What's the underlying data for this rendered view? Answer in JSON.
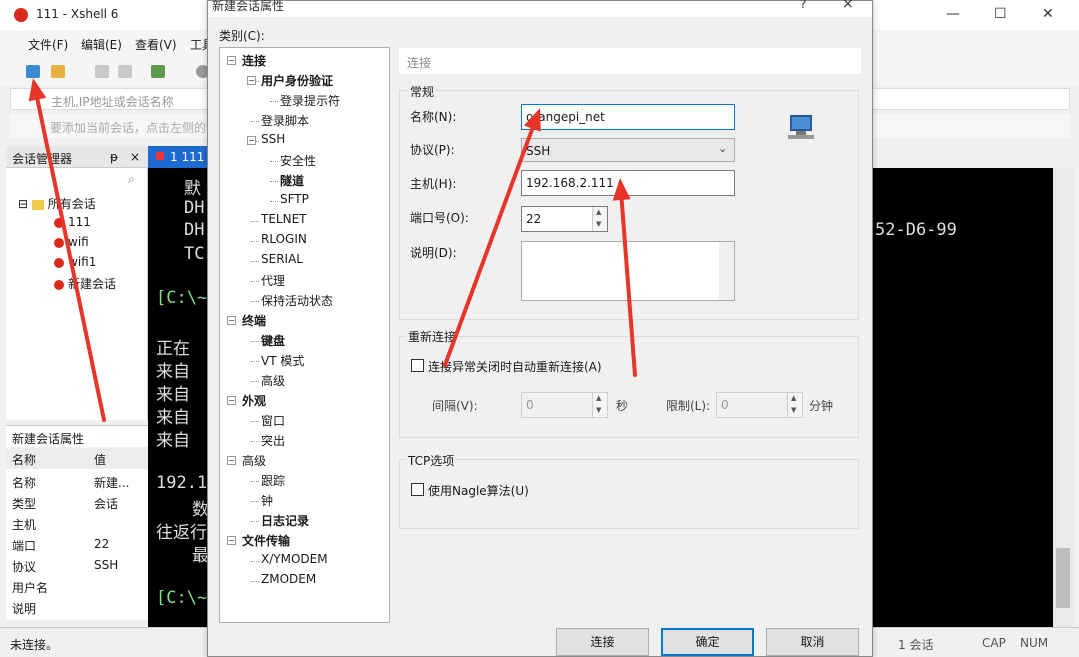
{
  "window": {
    "title": "111 - Xshell 6"
  },
  "menu": [
    "文件(F)",
    "编辑(E)",
    "查看(V)",
    "工具"
  ],
  "address_placeholder": "主机,IP地址或会话名称",
  "hint_text": "要添加当前会话，点击左侧的箭",
  "session_manager": {
    "title": "会话管理器",
    "pin": "ᵽ",
    "close": "×",
    "root": "所有会话",
    "items": [
      "111",
      "wifi",
      "wifi1",
      "新建会话"
    ]
  },
  "properties": {
    "title": "新建会话属性",
    "col_name": "名称",
    "col_value": "值",
    "rows": [
      [
        "名称",
        "新建..."
      ],
      [
        "类型",
        "会话"
      ],
      [
        "主机",
        ""
      ],
      [
        "端口",
        "22"
      ],
      [
        "协议",
        "SSH"
      ],
      [
        "用户名",
        ""
      ],
      [
        "说明",
        ""
      ]
    ]
  },
  "status": {
    "left": "未连接。",
    "sessions": "1 会话",
    "caps": "CAP",
    "num": "NUM"
  },
  "terminal": {
    "tab": "1 111",
    "lines": [
      "默",
      "DH(",
      "DH(",
      "TC",
      "",
      "[C:\\~",
      "",
      "正在",
      "来自",
      "来自",
      "来自",
      "来自",
      "",
      "192.1",
      "数",
      "往返行",
      "最",
      "",
      "[C:\\~"
    ],
    "right_text": "52-D6-99"
  },
  "dialog": {
    "title": "新建会话属性",
    "help": "?",
    "close": "×",
    "category_label": "类别(C):",
    "tree": [
      {
        "label": "连接",
        "level": 0,
        "bold": true
      },
      {
        "label": "用户身份验证",
        "level": 1,
        "bold": true
      },
      {
        "label": "登录提示符",
        "level": 2,
        "bold": false
      },
      {
        "label": "登录脚本",
        "level": 1,
        "bold": false
      },
      {
        "label": "SSH",
        "level": 1,
        "bold": false
      },
      {
        "label": "安全性",
        "level": 2,
        "bold": false
      },
      {
        "label": "隧道",
        "level": 2,
        "bold": true
      },
      {
        "label": "SFTP",
        "level": 2,
        "bold": false
      },
      {
        "label": "TELNET",
        "level": 1,
        "bold": false
      },
      {
        "label": "RLOGIN",
        "level": 1,
        "bold": false
      },
      {
        "label": "SERIAL",
        "level": 1,
        "bold": false
      },
      {
        "label": "代理",
        "level": 1,
        "bold": false
      },
      {
        "label": "保持活动状态",
        "level": 1,
        "bold": false
      },
      {
        "label": "终端",
        "level": 0,
        "bold": true
      },
      {
        "label": "键盘",
        "level": 1,
        "bold": true
      },
      {
        "label": "VT 模式",
        "level": 1,
        "bold": false
      },
      {
        "label": "高级",
        "level": 1,
        "bold": false
      },
      {
        "label": "外观",
        "level": 0,
        "bold": true
      },
      {
        "label": "窗口",
        "level": 1,
        "bold": false
      },
      {
        "label": "突出",
        "level": 1,
        "bold": false
      },
      {
        "label": "高级",
        "level": 0,
        "bold": false
      },
      {
        "label": "跟踪",
        "level": 1,
        "bold": false
      },
      {
        "label": "钟",
        "level": 1,
        "bold": false
      },
      {
        "label": "日志记录",
        "level": 1,
        "bold": true
      },
      {
        "label": "文件传输",
        "level": 0,
        "bold": true
      },
      {
        "label": "X/YMODEM",
        "level": 1,
        "bold": false
      },
      {
        "label": "ZMODEM",
        "level": 1,
        "bold": false
      }
    ],
    "panel_title": "连接",
    "general": {
      "label": "常规",
      "name_label": "名称(N):",
      "name_value": "orangepi_net",
      "protocol_label": "协议(P):",
      "protocol_value": "SSH",
      "host_label": "主机(H):",
      "host_value": "192.168.2.111",
      "port_label": "端口号(O):",
      "port_value": "22",
      "desc_label": "说明(D):",
      "desc_value": ""
    },
    "reconnect": {
      "label": "重新连接",
      "checkbox": "连接异常关闭时自动重新连接(A)",
      "checked": false,
      "interval_label": "间隔(V):",
      "interval_value": "0",
      "sec": "秒",
      "limit_label": "限制(L):",
      "limit_value": "0",
      "min": "分钟"
    },
    "tcp": {
      "label": "TCP选项",
      "checkbox": "使用Nagle算法(U)",
      "checked": false
    },
    "buttons": {
      "connect": "连接",
      "ok": "确定",
      "cancel": "取消"
    }
  },
  "annotation_color": "#e8352a"
}
